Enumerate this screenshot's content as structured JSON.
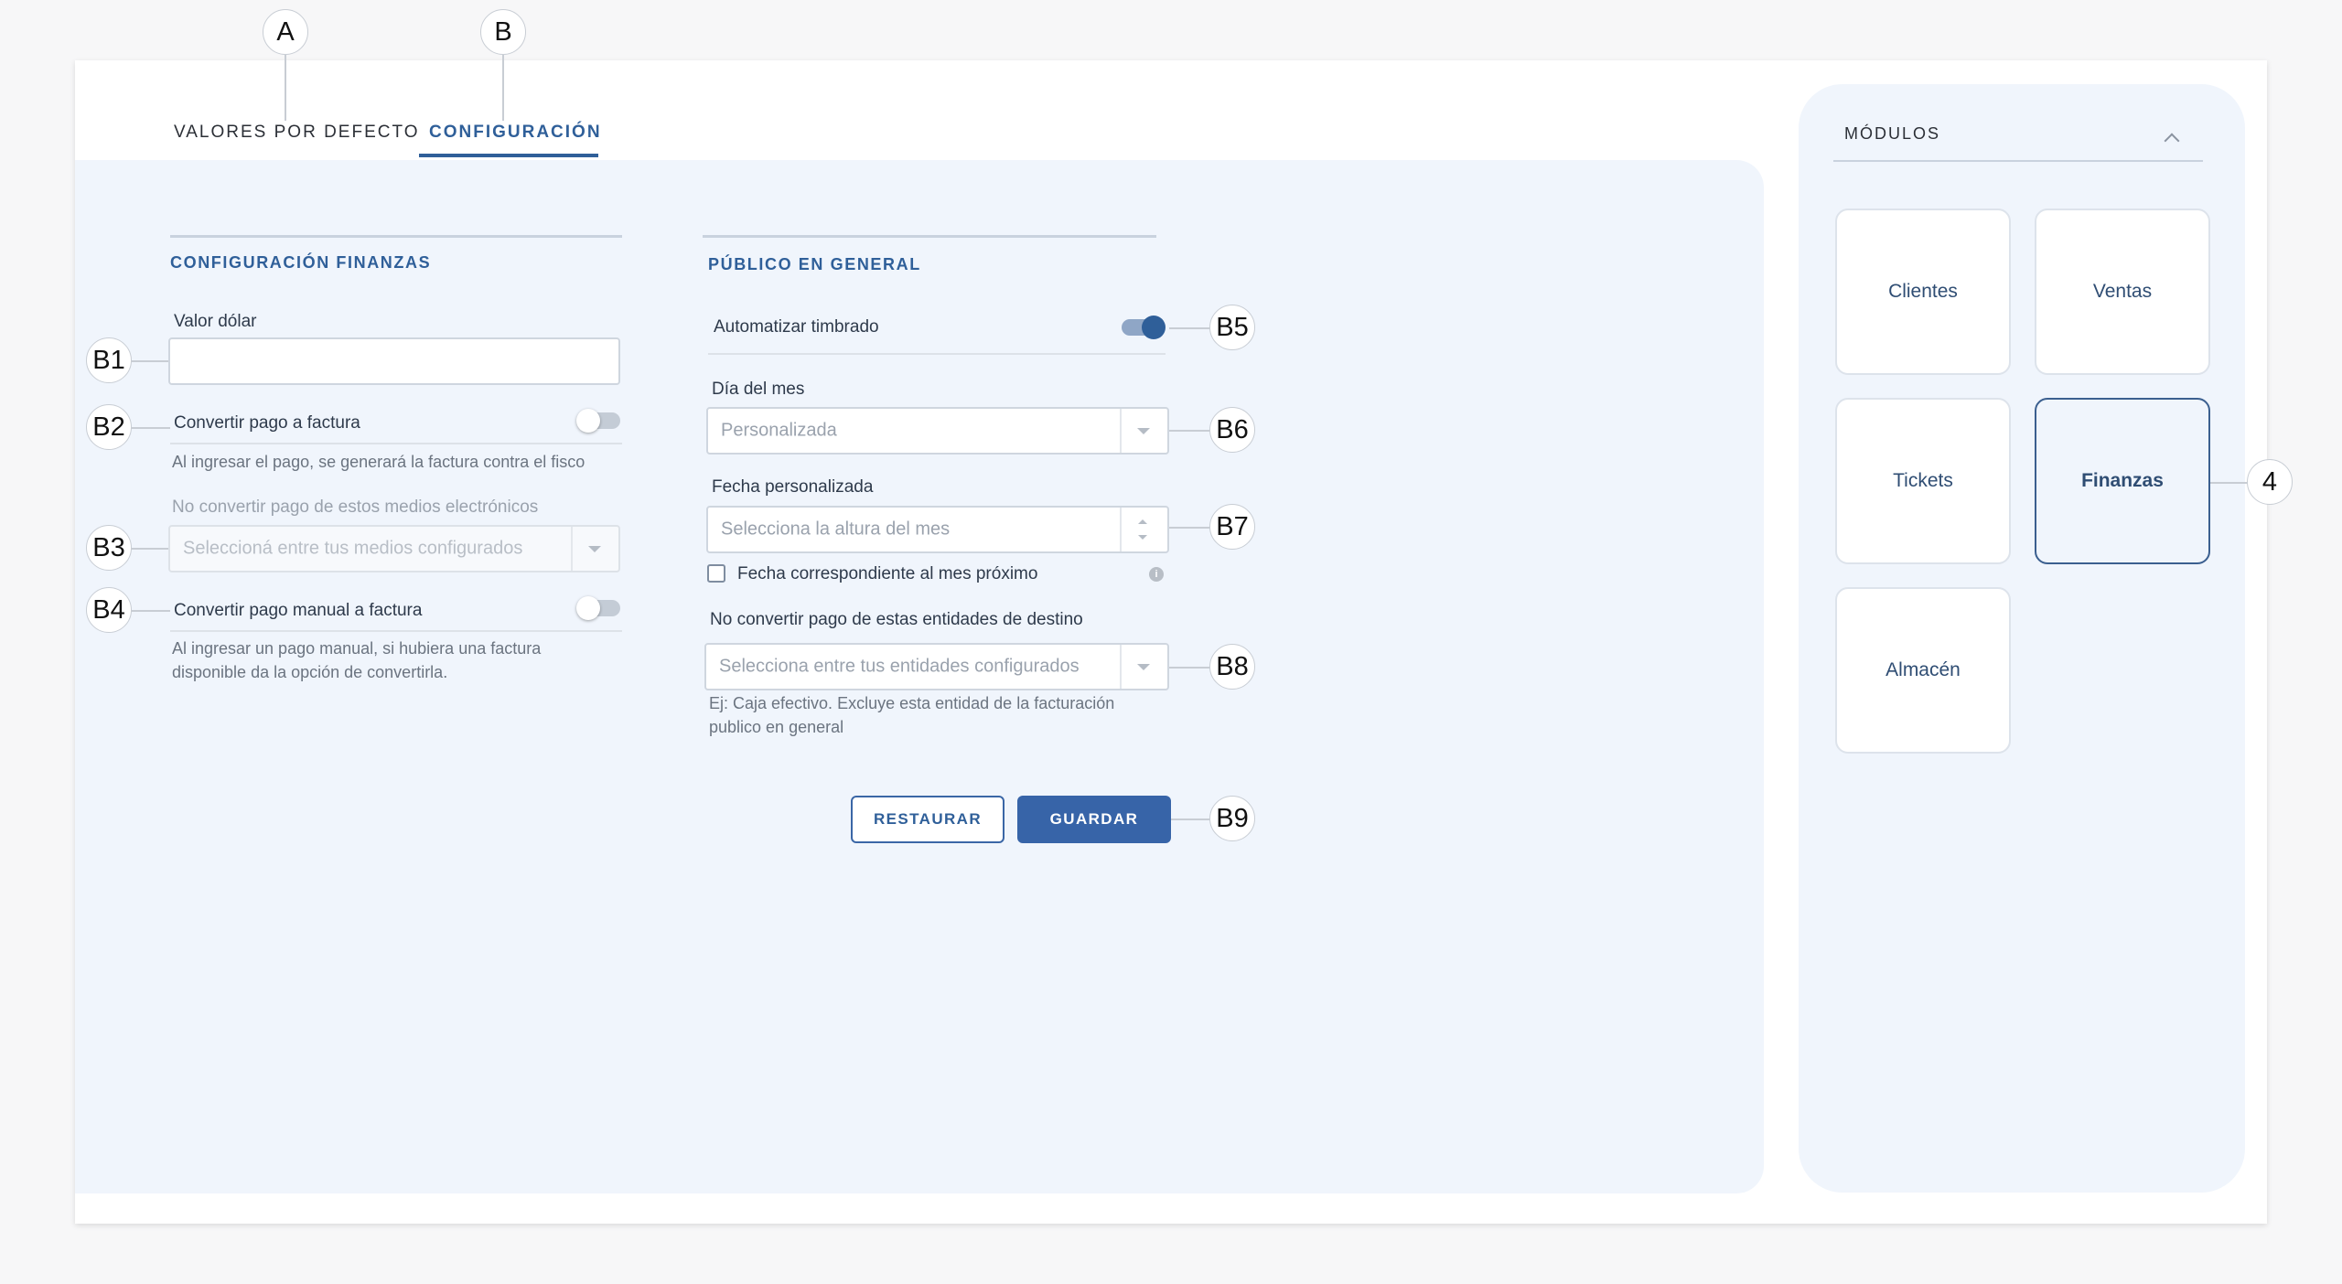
{
  "tabs": [
    {
      "label": "VALORES POR DEFECTO",
      "active": false
    },
    {
      "label": "CONFIGURACIÓN",
      "active": true
    }
  ],
  "finance": {
    "title": "CONFIGURACIÓN FINANZAS",
    "dollar_label": "Valor dólar",
    "dollar_value": "",
    "convert_payment": {
      "label": "Convertir pago a factura",
      "enabled": false,
      "help": "Al ingresar el pago, se generará la factura contra el fisco"
    },
    "exclude_methods": {
      "label": "No convertir pago de estos medios electrónicos",
      "placeholder": "Seleccioná entre tus medios configurados"
    },
    "convert_manual": {
      "label": "Convertir pago manual a factura",
      "enabled": false,
      "help_line1": "Al ingresar un pago manual, si hubiera una factura",
      "help_line2": "disponible da la opción de convertirla."
    }
  },
  "public": {
    "title": "PÚBLICO EN GENERAL",
    "auto_stamp": {
      "label": "Automatizar timbrado",
      "enabled": true
    },
    "day_of_month": {
      "label": "Día del mes",
      "value": "Personalizada"
    },
    "custom_date": {
      "label": "Fecha personalizada",
      "placeholder": "Selecciona la altura del mes"
    },
    "next_month": {
      "label": "Fecha correspondiente al mes próximo",
      "checked": false,
      "info_icon": "i"
    },
    "exclude_entities": {
      "label": "No convertir pago de estas entidades de destino",
      "placeholder": "Selecciona entre tus entidades configurados",
      "help_line1": "Ej: Caja efectivo. Excluye esta entidad de la facturación",
      "help_line2": "publico en general"
    }
  },
  "actions": {
    "restore": "RESTAURAR",
    "save": "GUARDAR"
  },
  "modules": {
    "title": "MÓDULOS",
    "items": [
      {
        "label": "Clientes",
        "active": false
      },
      {
        "label": "Ventas",
        "active": false
      },
      {
        "label": "Tickets",
        "active": false
      },
      {
        "label": "Finanzas",
        "active": true
      },
      {
        "label": "Almacén",
        "active": false
      }
    ]
  },
  "callouts": {
    "A": "A",
    "B": "B",
    "B1": "B1",
    "B2": "B2",
    "B3": "B3",
    "B4": "B4",
    "B5": "B5",
    "B6": "B6",
    "B7": "B7",
    "B8": "B8",
    "B9": "B9",
    "n4": "4"
  },
  "colors": {
    "accent": "#2f5f99",
    "panel": "#f0f5fc",
    "primary_button": "#3764a8"
  }
}
